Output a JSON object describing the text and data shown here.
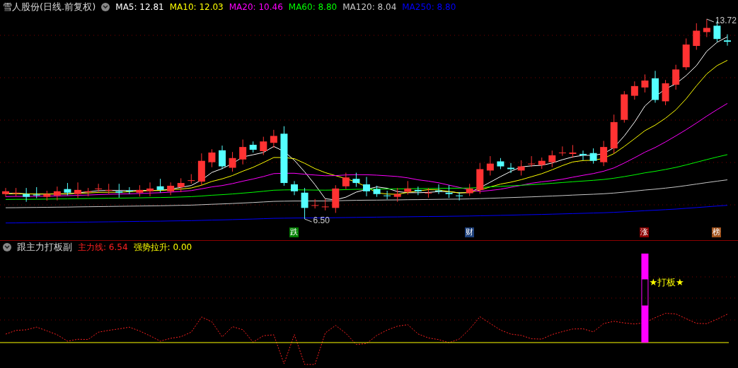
{
  "main_chart": {
    "title": "雪人股份(日线.前复权)",
    "legend": [
      {
        "label": "MA5: 12.81",
        "color": "#ffffff"
      },
      {
        "label": "MA10: 12.03",
        "color": "#ffff00"
      },
      {
        "label": "MA20: 10.46",
        "color": "#ff00ff"
      },
      {
        "label": "MA60: 8.80",
        "color": "#00ff00"
      },
      {
        "label": "MA120: 8.04",
        "color": "#c8c8c8"
      },
      {
        "label": "MA250: 8.80",
        "color": "#0000ff"
      }
    ],
    "high_label": "13.72",
    "low_label": "6.50",
    "event_markers": [
      {
        "label": "跌",
        "color": "#008000"
      },
      {
        "label": "财",
        "color": "#1c3f7a"
      },
      {
        "label": "涨",
        "color": "#8b0000"
      },
      {
        "label": "榜",
        "color": "#a0521c"
      }
    ]
  },
  "indicator_panel": {
    "title": "跟主力打板副",
    "legend": [
      {
        "label": "主力线: 6.54",
        "color": "#ff2020"
      },
      {
        "label": "强势拉升: 0.00",
        "color": "#ffff00"
      }
    ],
    "signal_label": "★打板★"
  }
}
